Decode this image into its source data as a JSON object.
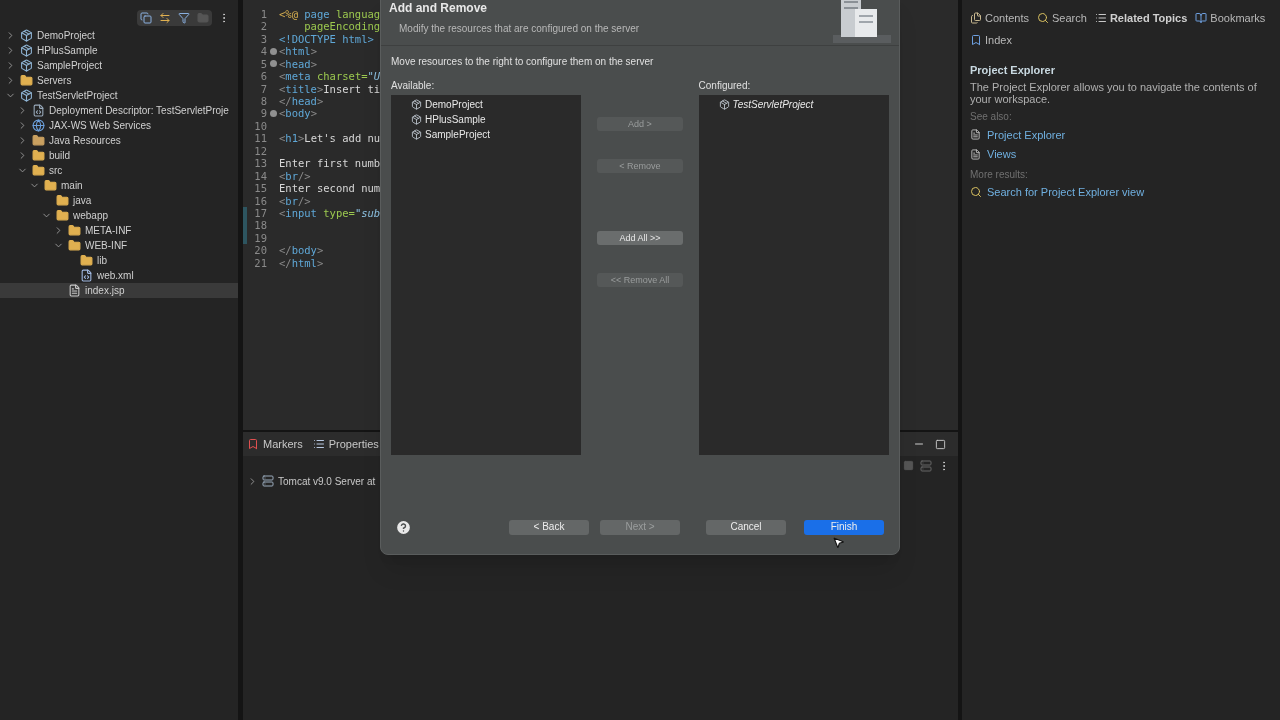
{
  "project_explorer": {
    "tree": [
      {
        "label": "DemoProject",
        "kind": "project",
        "expanded": false,
        "selected": false
      },
      {
        "label": "HPlusSample",
        "kind": "project",
        "expanded": false,
        "selected": false
      },
      {
        "label": "SampleProject",
        "kind": "project",
        "expanded": false,
        "selected": false
      },
      {
        "label": "Servers",
        "kind": "folder",
        "expanded": false,
        "selected": false
      },
      {
        "label": "TestServletProject",
        "kind": "project",
        "expanded": true,
        "selected": false,
        "children": [
          {
            "label": "Deployment Descriptor: TestServletProje",
            "kind": "descriptor",
            "expanded": false,
            "selected": false
          },
          {
            "label": "JAX-WS Web Services",
            "kind": "services",
            "expanded": false,
            "selected": false
          },
          {
            "label": "Java Resources",
            "kind": "resources",
            "expanded": false,
            "selected": false
          },
          {
            "label": "build",
            "kind": "folder",
            "expanded": false,
            "selected": false
          },
          {
            "label": "src",
            "kind": "folder",
            "expanded": true,
            "selected": false,
            "children": [
              {
                "label": "main",
                "kind": "folder",
                "expanded": true,
                "selected": false,
                "children": [
                  {
                    "label": "java",
                    "kind": "folder",
                    "selected": false
                  },
                  {
                    "label": "webapp",
                    "kind": "folder",
                    "expanded": true,
                    "selected": false,
                    "children": [
                      {
                        "label": "META-INF",
                        "kind": "folder",
                        "expanded": false,
                        "selected": false
                      },
                      {
                        "label": "WEB-INF",
                        "kind": "folder",
                        "expanded": true,
                        "selected": false,
                        "children": [
                          {
                            "label": "lib",
                            "kind": "folder",
                            "selected": false
                          },
                          {
                            "label": "web.xml",
                            "kind": "xml",
                            "selected": false
                          }
                        ]
                      },
                      {
                        "label": "index.jsp",
                        "kind": "jsp",
                        "selected": true
                      }
                    ]
                  }
                ]
              }
            ]
          }
        ]
      }
    ]
  },
  "editor": {
    "lines": [
      {
        "number": "1",
        "fold": false,
        "changed": false,
        "tokens": [
          {
            "kind": "directive",
            "text": "<%@"
          },
          {
            "kind": "tag",
            "text": " page"
          },
          {
            "kind": "attr",
            "text": " languag"
          }
        ]
      },
      {
        "number": "2",
        "fold": false,
        "changed": false,
        "tokens": [
          {
            "kind": "attr",
            "text": "    pageEncoding"
          }
        ]
      },
      {
        "number": "3",
        "fold": false,
        "changed": false,
        "tokens": [
          {
            "kind": "doctype",
            "text": "<!DOCTYPE html>"
          }
        ]
      },
      {
        "number": "4",
        "fold": true,
        "changed": false,
        "tokens": [
          {
            "kind": "bracket",
            "text": "<"
          },
          {
            "kind": "tag",
            "text": "html"
          },
          {
            "kind": "bracket",
            "text": ">"
          }
        ]
      },
      {
        "number": "5",
        "fold": true,
        "changed": false,
        "tokens": [
          {
            "kind": "bracket",
            "text": "<"
          },
          {
            "kind": "tag",
            "text": "head"
          },
          {
            "kind": "bracket",
            "text": ">"
          }
        ]
      },
      {
        "number": "6",
        "fold": false,
        "changed": false,
        "tokens": [
          {
            "kind": "bracket",
            "text": "<"
          },
          {
            "kind": "tag",
            "text": "meta"
          },
          {
            "kind": "attr",
            "text": " charset="
          },
          {
            "kind": "string",
            "text": "\"U"
          }
        ]
      },
      {
        "number": "7",
        "fold": false,
        "changed": false,
        "tokens": [
          {
            "kind": "bracket",
            "text": "<"
          },
          {
            "kind": "tag",
            "text": "title"
          },
          {
            "kind": "bracket",
            "text": ">"
          },
          {
            "kind": "text",
            "text": "Insert ti"
          }
        ]
      },
      {
        "number": "8",
        "fold": false,
        "changed": false,
        "tokens": [
          {
            "kind": "bracket",
            "text": "</"
          },
          {
            "kind": "tag",
            "text": "head"
          },
          {
            "kind": "bracket",
            "text": ">"
          }
        ]
      },
      {
        "number": "9",
        "fold": true,
        "changed": false,
        "tokens": [
          {
            "kind": "bracket",
            "text": "<"
          },
          {
            "kind": "tag",
            "text": "body"
          },
          {
            "kind": "bracket",
            "text": ">"
          }
        ]
      },
      {
        "number": "10",
        "fold": false,
        "changed": false
      },
      {
        "number": "11",
        "fold": false,
        "changed": false,
        "tokens": [
          {
            "kind": "bracket",
            "text": "<"
          },
          {
            "kind": "tag",
            "text": "h1"
          },
          {
            "kind": "bracket",
            "text": ">"
          },
          {
            "kind": "text",
            "text": "Let's add nu"
          }
        ]
      },
      {
        "number": "12",
        "fold": false,
        "changed": false
      },
      {
        "number": "13",
        "fold": false,
        "changed": false,
        "tokens": [
          {
            "kind": "text",
            "text": "Enter first numb"
          }
        ]
      },
      {
        "number": "14",
        "fold": false,
        "changed": false,
        "tokens": [
          {
            "kind": "bracket",
            "text": "<"
          },
          {
            "kind": "tag",
            "text": "br"
          },
          {
            "kind": "bracket",
            "text": "/>"
          }
        ]
      },
      {
        "number": "15",
        "fold": false,
        "changed": false,
        "tokens": [
          {
            "kind": "text",
            "text": "Enter second num"
          }
        ]
      },
      {
        "number": "16",
        "fold": false,
        "changed": false,
        "tokens": [
          {
            "kind": "bracket",
            "text": "<"
          },
          {
            "kind": "tag",
            "text": "br"
          },
          {
            "kind": "bracket",
            "text": "/>"
          }
        ]
      },
      {
        "number": "17",
        "fold": false,
        "changed": true,
        "tokens": [
          {
            "kind": "bracket",
            "text": "<"
          },
          {
            "kind": "tag",
            "text": "input"
          },
          {
            "kind": "attr",
            "text": " type="
          },
          {
            "kind": "string",
            "text": "\"sub"
          }
        ]
      },
      {
        "number": "18",
        "fold": false,
        "changed": true
      },
      {
        "number": "19",
        "fold": false,
        "changed": true
      },
      {
        "number": "20",
        "fold": false,
        "changed": false,
        "tokens": [
          {
            "kind": "bracket",
            "text": "</"
          },
          {
            "kind": "tag",
            "text": "body"
          },
          {
            "kind": "bracket",
            "text": ">"
          }
        ]
      },
      {
        "number": "21",
        "fold": false,
        "changed": false,
        "tokens": [
          {
            "kind": "bracket",
            "text": "</"
          },
          {
            "kind": "tag",
            "text": "html"
          },
          {
            "kind": "bracket",
            "text": ">"
          }
        ]
      }
    ]
  },
  "bottom_panel": {
    "tabs": [
      {
        "label": "Markers",
        "kind": "markers"
      },
      {
        "label": "Properties",
        "kind": "properties"
      }
    ],
    "servers": [
      {
        "label": "Tomcat v9.0 Server at",
        "expanded": false
      }
    ]
  },
  "help": {
    "tabs": [
      {
        "label": "Contents",
        "kind": "contents",
        "selected": false
      },
      {
        "label": "Search",
        "kind": "search",
        "selected": false
      },
      {
        "label": "Related Topics",
        "kind": "related",
        "selected": true
      },
      {
        "label": "Bookmarks",
        "kind": "bookmarks",
        "selected": false
      },
      {
        "label": "Index",
        "kind": "index",
        "selected": false
      }
    ],
    "heading": "Project Explorer",
    "description": "The Project Explorer allows you to navigate the contents of your workspace.",
    "see_also_label": "See also:",
    "see_also": [
      "Project Explorer",
      "Views"
    ],
    "more_results_label": "More results:",
    "more_results": [
      "Search for Project Explorer view"
    ]
  },
  "dialog": {
    "title": "Add and Remove",
    "subtitle": "Modify the resources that are configured on the server",
    "instruction": "Move resources to the right to configure them on the server",
    "available_label": "Available:",
    "available": [
      "DemoProject",
      "HPlusSample",
      "SampleProject"
    ],
    "configured_label": "Configured:",
    "configured": [
      "TestServletProject"
    ],
    "move_buttons": [
      {
        "label": "Add >",
        "disabled": true
      },
      {
        "label": "< Remove",
        "disabled": true
      },
      {
        "label": "Add All >>",
        "disabled": false
      },
      {
        "label": "<< Remove All",
        "disabled": true
      }
    ],
    "footer_buttons": [
      {
        "label": "< Back",
        "disabled": false,
        "primary": false
      },
      {
        "label": "Next >",
        "disabled": true,
        "primary": false
      },
      {
        "label": "Cancel",
        "disabled": false,
        "primary": false
      },
      {
        "label": "Finish",
        "disabled": false,
        "primary": true
      }
    ]
  }
}
